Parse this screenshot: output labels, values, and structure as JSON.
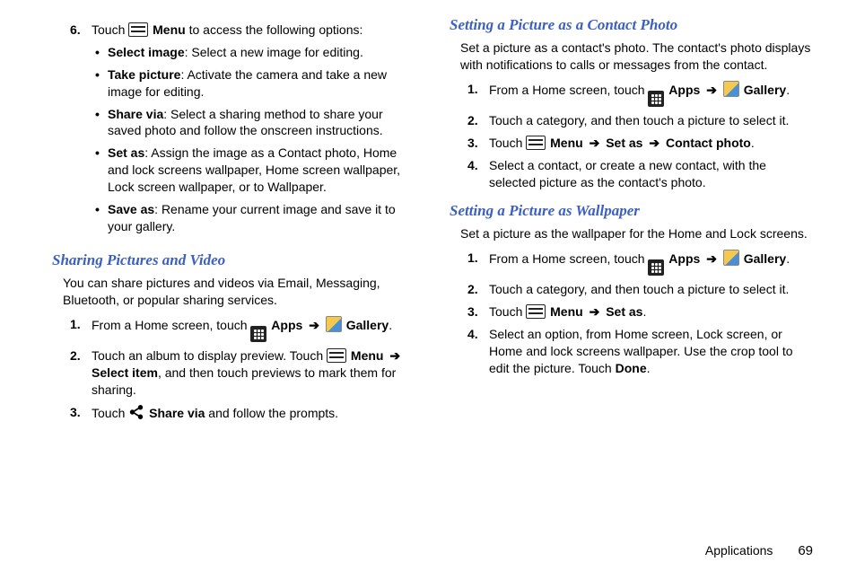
{
  "left": {
    "step6": {
      "num": "6.",
      "prefix": "Touch ",
      "menu": "Menu",
      "suffix": " to access the following options:",
      "bullets": [
        {
          "title": "Select image",
          "text": ": Select a new image for editing."
        },
        {
          "title": "Take picture",
          "text": ": Activate the camera and take a new image for editing."
        },
        {
          "title": "Share via",
          "text": ": Select a sharing method to share your saved photo and follow the onscreen instructions."
        },
        {
          "title": "Set as",
          "text": ": Assign the image as a Contact photo, Home and lock screens wallpaper, Home screen wallpaper, Lock screen wallpaper, or to Wallpaper."
        },
        {
          "title": "Save as",
          "text": ": Rename your current image and save it to your gallery."
        }
      ]
    },
    "share_heading": "Sharing Pictures and Video",
    "share_intro": "You can share pictures and videos via Email, Messaging, Bluetooth, or popular sharing services.",
    "share_steps": [
      {
        "num": "1.",
        "pre": "From a Home screen, touch ",
        "apps": "Apps",
        "arrow": "➔",
        "gallery": "Gallery",
        "post": "."
      },
      {
        "num": "2.",
        "pre": "Touch an album to display preview. Touch ",
        "menu": "Menu",
        "arrow": "➔",
        "select_item": "Select item",
        "post": ", and then touch previews to mark them for sharing."
      },
      {
        "num": "3.",
        "pre": "Touch ",
        "share": "Share via",
        "post": " and follow the prompts."
      }
    ]
  },
  "right": {
    "contact_heading": "Setting a Picture as a Contact Photo",
    "contact_intro": "Set a picture as a contact's photo. The contact's photo displays with notifications to calls or messages from the contact.",
    "contact_steps": [
      {
        "num": "1.",
        "pre": "From a Home screen, touch ",
        "apps": "Apps",
        "arrow": "➔",
        "gallery": "Gallery",
        "post": "."
      },
      {
        "num": "2.",
        "text": "Touch a category, and then touch a picture to select it."
      },
      {
        "num": "3.",
        "pre": "Touch ",
        "menu": "Menu",
        "arrow": "➔",
        "setas": "Set as",
        "arrow2": "➔",
        "contactphoto": "Contact photo",
        "post": "."
      },
      {
        "num": "4.",
        "text": "Select a contact, or create a new contact, with the selected picture as the contact's photo."
      }
    ],
    "wall_heading": "Setting a Picture as Wallpaper",
    "wall_intro": "Set a picture as the wallpaper for the Home and Lock screens.",
    "wall_steps": [
      {
        "num": "1.",
        "pre": "From a Home screen, touch ",
        "apps": "Apps",
        "arrow": "➔",
        "gallery": "Gallery",
        "post": "."
      },
      {
        "num": "2.",
        "text": "Touch a category, and then touch a picture to select it."
      },
      {
        "num": "3.",
        "pre": "Touch ",
        "menu": "Menu",
        "arrow": "➔",
        "setas": "Set as",
        "post": "."
      },
      {
        "num": "4.",
        "pre": "Select an option, from Home screen, Lock screen, or Home and lock screens wallpaper. Use the crop tool to edit the picture. Touch ",
        "done": "Done",
        "post": "."
      }
    ]
  },
  "footer": {
    "section": "Applications",
    "page": "69"
  }
}
